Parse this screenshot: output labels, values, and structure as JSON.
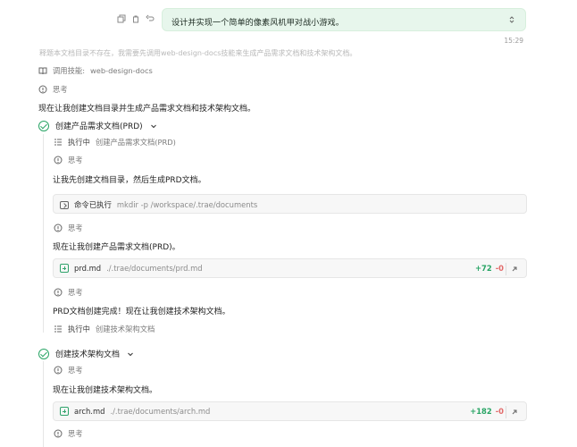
{
  "top_message": {
    "text": "设计并实现一个简单的像素风机甲对战小游戏。",
    "time": "15:29",
    "actions": [
      "copy-icon",
      "trash-icon",
      "undo-icon"
    ]
  },
  "faded_previous_text": "释题本文档目录不存在，我需要先调用web-design-docs技能来生成产品需求文档和技术架构文档。",
  "skill": {
    "label": "调用技能:",
    "name": "web-design-docs"
  },
  "thinking_label": "思考",
  "intro_text": "现在让我创建文档目录并生成产品需求文档和技术架构文档。",
  "tasks": [
    {
      "title": "创建产品需求文档(PRD)",
      "running_label": "执行中",
      "running_detail": "创建产品需求文档(PRD)",
      "steps": [
        {
          "text": "让我先创建文档目录，然后生成PRD文档。"
        },
        {
          "text": "现在让我创建产品需求文档(PRD)。"
        },
        {
          "text": "PRD文档创建完成！现在让我创建技术架构文档。"
        }
      ],
      "command": {
        "label": "命令已执行",
        "value": "mkdir -p /workspace/.trae/documents"
      },
      "file": {
        "name": "prd.md",
        "path": "./.trae/documents/prd.md",
        "add": "+72",
        "del": "-0"
      }
    },
    {
      "title": "创建技术架构文档",
      "running_label": "执行中",
      "running_detail": "创建技术架构文档",
      "steps": [
        {
          "text": "现在让我创建技术架构文档。"
        }
      ],
      "file": {
        "name": "arch.md",
        "path": "./.trae/documents/arch.md",
        "add": "+182",
        "del": "-0"
      }
    }
  ]
}
